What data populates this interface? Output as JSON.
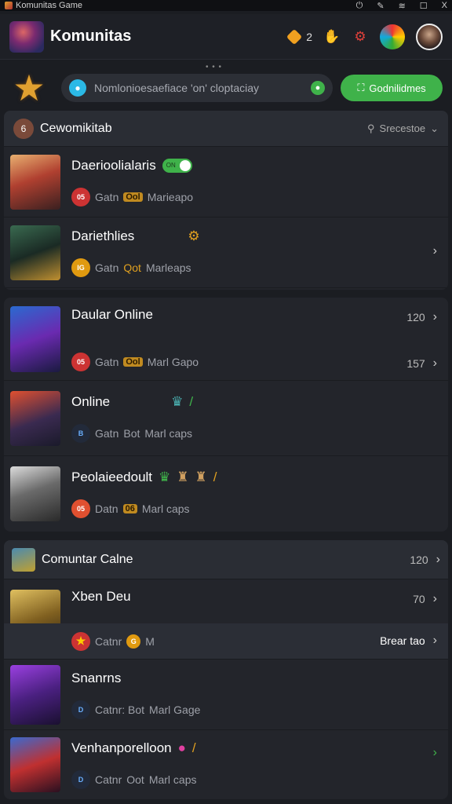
{
  "window": {
    "title": "Komunitas Game"
  },
  "header": {
    "title": "Komunitas",
    "coins": "2"
  },
  "search": {
    "placeholder": "Nomlonioesaefiace 'on' cloptaciay",
    "button_label": "Godnilidmes"
  },
  "sections": [
    {
      "title": "Cewomikitab",
      "tools_label": "Srecestoe",
      "rows": [
        {
          "title": "Daerioolialaris",
          "sub_a": "Gatn",
          "sub_tag": "Ool",
          "sub_b": "Marieapo",
          "badge": "05",
          "toggle_label": "ON"
        },
        {
          "title": "Dariethlies",
          "sub_a": "Gatn",
          "sub_tag": "Qot",
          "sub_b": "Marleaps",
          "badge": "IG"
        }
      ]
    },
    {
      "rows": [
        {
          "title": "Daular Online",
          "sub_a": "Gatn",
          "sub_tag": "Ool",
          "sub_b": "Marl Gapo",
          "badge": "05",
          "meta_top": "120",
          "meta_bottom": "157"
        },
        {
          "title": "Online",
          "sub_a": "Gatn",
          "sub_tag": "Bot",
          "sub_b": "Marl caps",
          "badge": "B"
        },
        {
          "title": "Peolaieedoult",
          "sub_a": "Datn",
          "sub_tag": "06",
          "sub_b": "Marl caps",
          "badge": "05"
        }
      ]
    },
    {
      "title": "Comuntar Calne",
      "meta": "120",
      "rows": [
        {
          "title": "Xben Deu",
          "meta": "70"
        },
        {
          "sub_a": "Catnr",
          "sub_b": "M",
          "meta": "Brear tao",
          "badge": "★"
        },
        {
          "title": "Snanrns",
          "sub_a": "Catnr: Bot",
          "sub_b": "Marl Gage",
          "badge": "D"
        },
        {
          "title": "Venhanporelloon",
          "sub_a": "Catnr",
          "sub_tag": "Oot",
          "sub_b": "Marl caps",
          "badge": "D"
        }
      ]
    }
  ]
}
